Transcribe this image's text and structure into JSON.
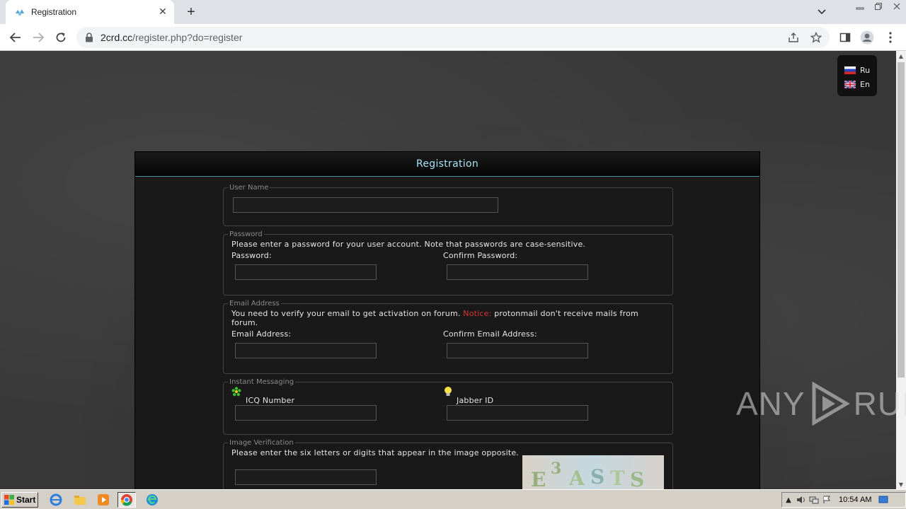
{
  "browser": {
    "tab_title": "Registration",
    "url_host": "2crd.cc",
    "url_path": "/register.php?do=register"
  },
  "lang": {
    "items": [
      "Ru",
      "En"
    ]
  },
  "form": {
    "title": "Registration",
    "username": {
      "legend": "User Name",
      "value": ""
    },
    "password": {
      "legend": "Password",
      "hint": "Please enter a password for your user account. Note that passwords are case-sensitive.",
      "label": "Password:",
      "confirm_label": "Confirm Password:"
    },
    "email": {
      "legend": "Email Address",
      "hint_prefix": "You need to verify your email to get activation on forum.",
      "notice": "Notice:",
      "hint_suffix": "protonmail don't receive mails from",
      "hint_line2": "forum.",
      "label": "Email Address:",
      "confirm_label": "Confirm Email Address:"
    },
    "im": {
      "legend": "Instant Messaging",
      "icq_label": "ICQ Number",
      "jabber_label": "Jabber ID"
    },
    "verify": {
      "legend": "Image Verification",
      "hint": "Please enter the six letters or digits that appear in the image opposite.",
      "captcha_chars": [
        "E",
        "3",
        "A",
        "S",
        "T",
        "S"
      ]
    }
  },
  "watermark": {
    "text_left": "ANY",
    "text_right": "RUN"
  },
  "taskbar": {
    "start_label": "Start",
    "clock": "10:54 AM"
  },
  "colors": {
    "accent": "#a8e3f5",
    "notice": "#dd3333",
    "page_bg": "#383838"
  }
}
